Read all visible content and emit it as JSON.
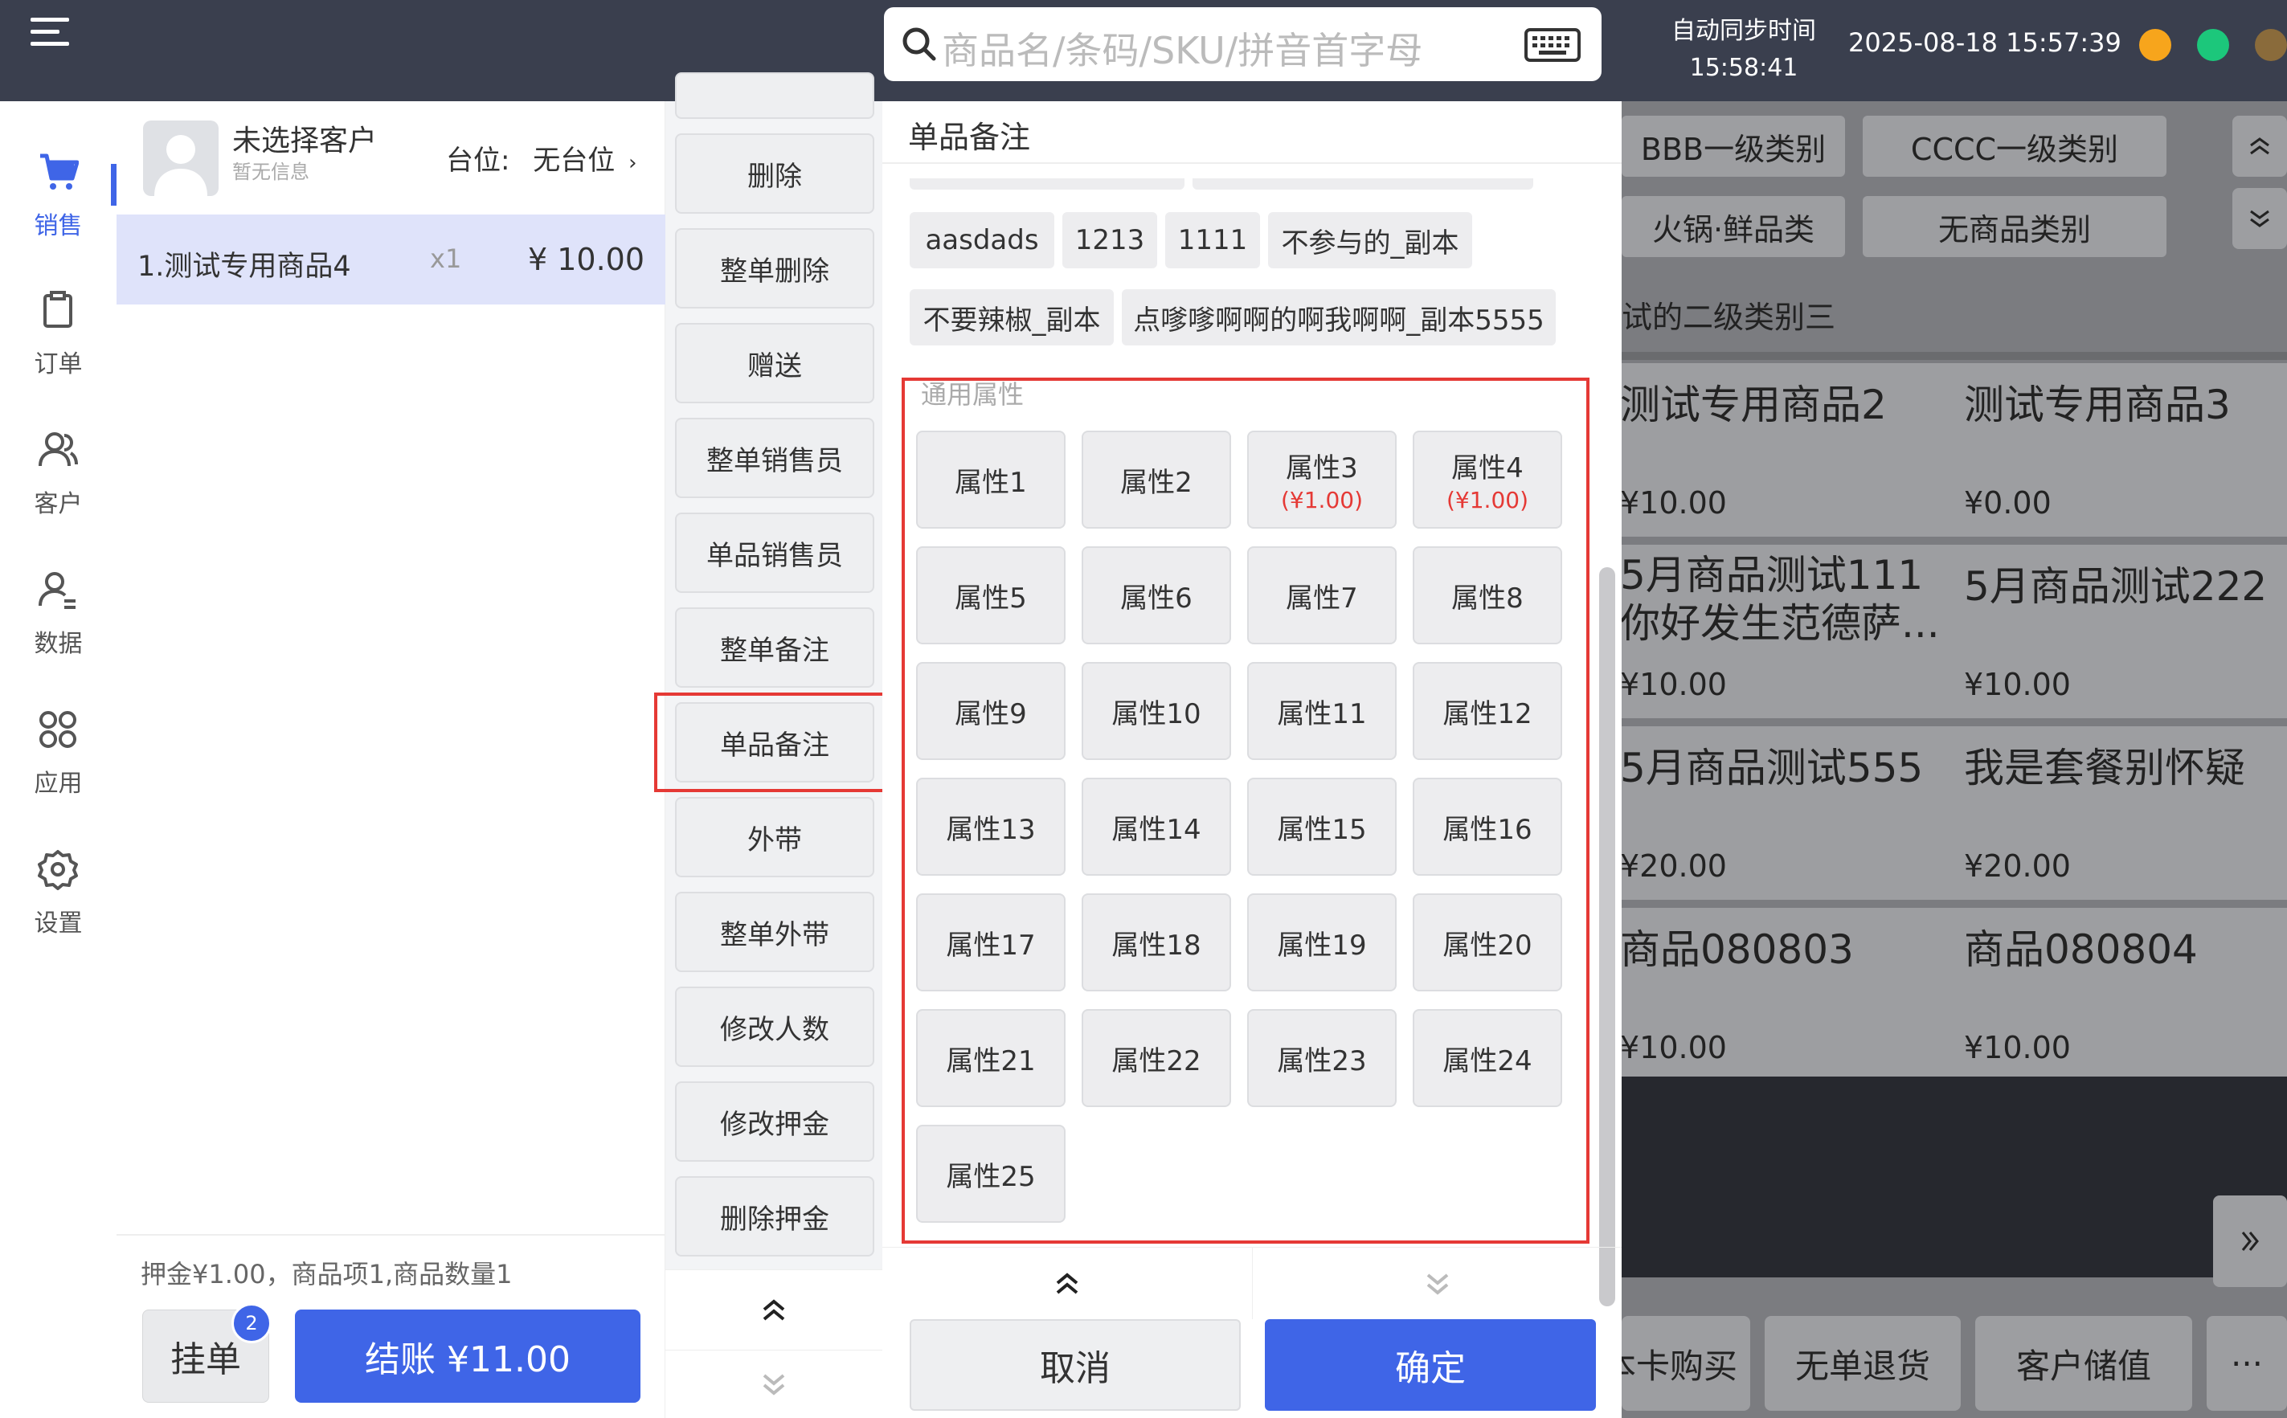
{
  "topbar": {
    "search_placeholder": "商品名/条码/SKU/拼音首字母",
    "sync_label": "自动同步时间",
    "sync_time": "15:58:41",
    "datetime": "2025-08-18 15:57:39"
  },
  "nav": {
    "items": [
      {
        "label": "销售",
        "icon": "cart-icon"
      },
      {
        "label": "订单",
        "icon": "clipboard-icon"
      },
      {
        "label": "客户",
        "icon": "users-icon"
      },
      {
        "label": "数据",
        "icon": "user-data-icon"
      },
      {
        "label": "应用",
        "icon": "apps-grid-icon"
      },
      {
        "label": "设置",
        "icon": "gear-icon"
      }
    ]
  },
  "customer": {
    "name": "未选择客户",
    "info": "暂无信息",
    "table_label": "台位:",
    "table_value": "无台位"
  },
  "order": {
    "items": [
      {
        "name": "1.测试专用商品4",
        "qty": "x1",
        "price": "¥ 10.00"
      }
    ],
    "summary": "押金¥1.00，商品项1,商品数量1",
    "hang_label": "挂单",
    "hang_badge": "2",
    "checkout_label": "结账 ¥11.00"
  },
  "actions": [
    "删除",
    "整单删除",
    "赠送",
    "整单销售员",
    "单品销售员",
    "整单备注",
    "单品备注",
    "外带",
    "整单外带",
    "修改人数",
    "修改押金",
    "删除押金"
  ],
  "modal": {
    "title": "单品备注",
    "tags_row1": [
      "aasdads",
      "1213",
      "1111",
      "不参与的_副本"
    ],
    "tags_row2": [
      "不要辣椒_副本",
      "点嗲嗲啊啊的啊我啊啊_副本5555"
    ],
    "group_label": "通用属性",
    "attributes": [
      {
        "name": "属性1",
        "price": ""
      },
      {
        "name": "属性2",
        "price": ""
      },
      {
        "name": "属性3",
        "price": "(¥1.00)"
      },
      {
        "name": "属性4",
        "price": "(¥1.00)"
      },
      {
        "name": "属性5",
        "price": ""
      },
      {
        "name": "属性6",
        "price": ""
      },
      {
        "name": "属性7",
        "price": ""
      },
      {
        "name": "属性8",
        "price": ""
      },
      {
        "name": "属性9",
        "price": ""
      },
      {
        "name": "属性10",
        "price": ""
      },
      {
        "name": "属性11",
        "price": ""
      },
      {
        "name": "属性12",
        "price": ""
      },
      {
        "name": "属性13",
        "price": ""
      },
      {
        "name": "属性14",
        "price": ""
      },
      {
        "name": "属性15",
        "price": ""
      },
      {
        "name": "属性16",
        "price": ""
      },
      {
        "name": "属性17",
        "price": ""
      },
      {
        "name": "属性18",
        "price": ""
      },
      {
        "name": "属性19",
        "price": ""
      },
      {
        "name": "属性20",
        "price": ""
      },
      {
        "name": "属性21",
        "price": ""
      },
      {
        "name": "属性22",
        "price": ""
      },
      {
        "name": "属性23",
        "price": ""
      },
      {
        "name": "属性24",
        "price": ""
      },
      {
        "name": "属性25",
        "price": ""
      }
    ],
    "cancel_label": "取消",
    "confirm_label": "确定"
  },
  "background": {
    "categories": [
      "BBB一级类别",
      "CCCC一级类别",
      "火锅·鲜品类",
      "无商品类别"
    ],
    "subcategory": "试的二级类别三",
    "products": [
      {
        "name": "测试专用商品2",
        "price": "¥10.00"
      },
      {
        "name": "测试专用商品3",
        "price": "¥0.00"
      },
      {
        "name": "5月商品测试111\n你好发生范德萨...",
        "price": "¥10.00"
      },
      {
        "name": "5月商品测试222",
        "price": "¥10.00"
      },
      {
        "name": "5月商品测试555",
        "price": "¥20.00"
      },
      {
        "name": "我是套餐别怀疑",
        "price": "¥20.00"
      },
      {
        "name": "商品080803",
        "price": "¥10.00"
      },
      {
        "name": "商品080804",
        "price": "¥10.00"
      }
    ],
    "bottom_buttons": [
      "本卡购买",
      "无单退货",
      "客户储值",
      "···"
    ]
  },
  "colors": {
    "topbar": "#3a3f4e",
    "accent": "#3f65e7",
    "highlight": "#e53935",
    "attr_price": "#e53935"
  }
}
